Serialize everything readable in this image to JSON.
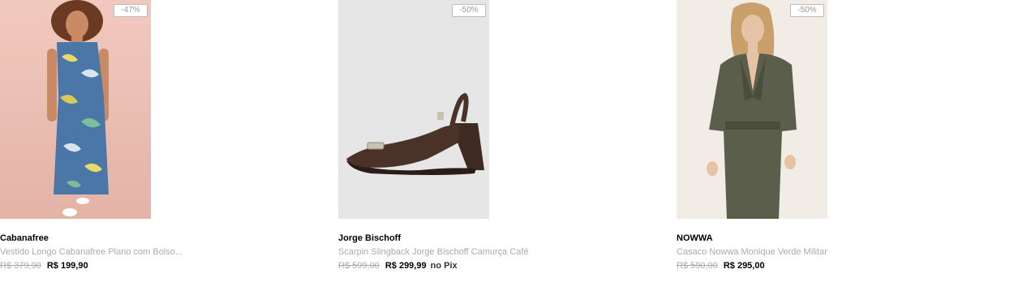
{
  "products": [
    {
      "brand": "Cabanafree",
      "title": "Vestido Longo Cabanafree Plano com Bolso...",
      "old_price": "R$ 379,90",
      "new_price": "R$ 199,90",
      "pix_label": "",
      "discount": "-47%"
    },
    {
      "brand": "Jorge Bischoff",
      "title": "Scarpin Slingback Jorge Bischoff Camurça Café",
      "old_price": "R$ 599,00",
      "new_price": "R$ 299,99",
      "pix_label": "no Pix",
      "discount": "-50%"
    },
    {
      "brand": "NOWWA",
      "title": "Casaco Nowwa Monique Verde Militar",
      "old_price": "R$ 590,00",
      "new_price": "R$ 295,00",
      "pix_label": "",
      "discount": "-50%"
    }
  ]
}
